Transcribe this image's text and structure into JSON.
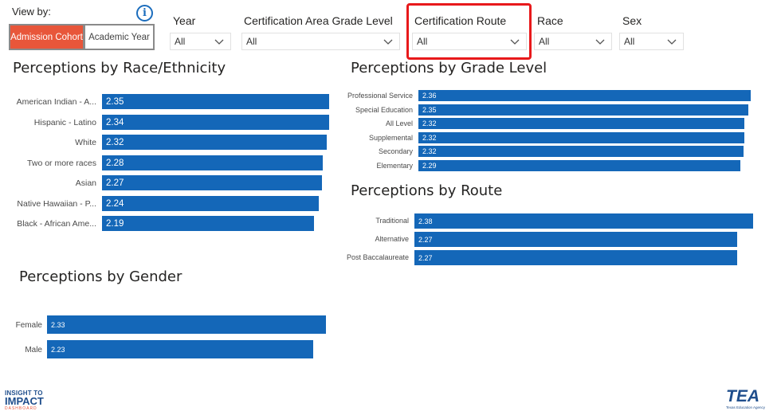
{
  "viewby": {
    "label": "View by:",
    "options": [
      "Admission Cohort",
      "Academic Year"
    ],
    "selected": "Admission Cohort"
  },
  "filters": [
    {
      "label": "Year",
      "value": "All"
    },
    {
      "label": "Certification Area Grade Level",
      "value": "All"
    },
    {
      "label": "Certification Route",
      "value": "All"
    },
    {
      "label": "Race",
      "value": "All"
    },
    {
      "label": "Sex",
      "value": "All"
    }
  ],
  "colors": {
    "bar": "#1467b8",
    "accent": "#e8563a",
    "highlight": "#e8191b"
  },
  "sections": {
    "race": {
      "title": "Perceptions by Race/Ethnicity",
      "items": [
        {
          "label": "American Indian - A...",
          "value": "2.35"
        },
        {
          "label": "Hispanic - Latino",
          "value": "2.34"
        },
        {
          "label": "White",
          "value": "2.32"
        },
        {
          "label": "Two or more races",
          "value": "2.28"
        },
        {
          "label": "Asian",
          "value": "2.27"
        },
        {
          "label": "Native Hawaiian - P...",
          "value": "2.24"
        },
        {
          "label": "Black - African Ame...",
          "value": "2.19"
        }
      ]
    },
    "gender": {
      "title": "Perceptions by Gender",
      "items": [
        {
          "label": "Female",
          "value": "2.33"
        },
        {
          "label": "Male",
          "value": "2.23"
        }
      ]
    },
    "grade": {
      "title": "Perceptions by Grade Level",
      "items": [
        {
          "label": "Professional Service",
          "value": "2.36"
        },
        {
          "label": "Special Education",
          "value": "2.35"
        },
        {
          "label": "All Level",
          "value": "2.32"
        },
        {
          "label": "Supplemental",
          "value": "2.32"
        },
        {
          "label": "Secondary",
          "value": "2.32"
        },
        {
          "label": "Elementary",
          "value": "2.29"
        }
      ]
    },
    "route": {
      "title": "Perceptions by Route",
      "items": [
        {
          "label": "Traditional",
          "value": "2.38"
        },
        {
          "label": "Alternative",
          "value": "2.27"
        },
        {
          "label": "Post Baccalaureate",
          "value": "2.27"
        }
      ]
    }
  },
  "logos": {
    "left": {
      "line1": "INSIGHT TO",
      "line2": "IMPACT",
      "line3": "DASHBOARD"
    },
    "right": {
      "name": "TEA",
      "sub": "Texas Education Agency"
    }
  }
}
